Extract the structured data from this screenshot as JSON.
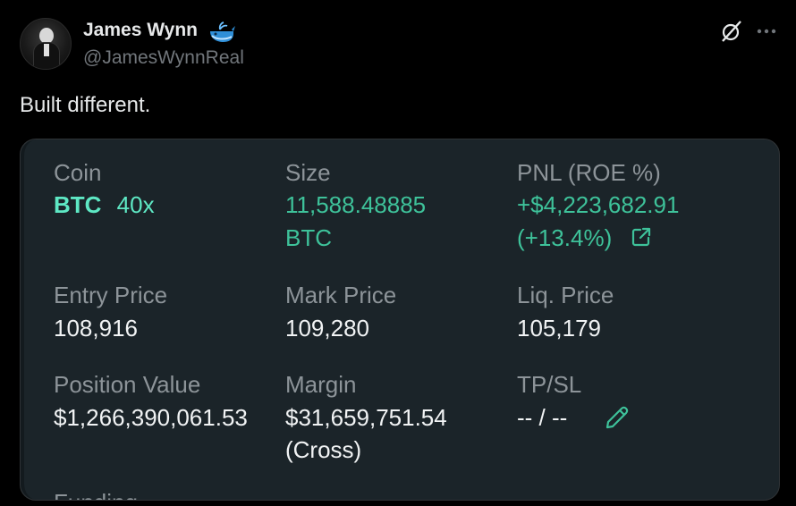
{
  "author": {
    "name": "James Wynn",
    "handle": "@JamesWynnReal",
    "emoji_icon": "whale-icon"
  },
  "tweet": {
    "text": "Built different."
  },
  "position": {
    "coin_label": "Coin",
    "coin": "BTC",
    "leverage": "40x",
    "size_label": "Size",
    "size_value": "11,588.48885",
    "size_unit": "BTC",
    "pnl_label": "PNL (ROE %)",
    "pnl_value": "+$4,223,682.91",
    "roe_value": "(+13.4%)",
    "entry_label": "Entry Price",
    "entry_value": "108,916",
    "mark_label": "Mark Price",
    "mark_value": "109,280",
    "liq_label": "Liq. Price",
    "liq_value": "105,179",
    "posval_label": "Position Value",
    "posval_value": "$1,266,390,061.53",
    "margin_label": "Margin",
    "margin_value": "$31,659,751.54",
    "margin_mode": "(Cross)",
    "tpsl_label": "TP/SL",
    "tpsl_value": "-- / --",
    "funding_label": "Funding"
  },
  "colors": {
    "background": "#000000",
    "card": "#1b2429",
    "accent_green": "#3ec29a",
    "coin_teal": "#5ee8c4",
    "muted": "#8d9499",
    "whale_blue": "#1d9bf0"
  }
}
